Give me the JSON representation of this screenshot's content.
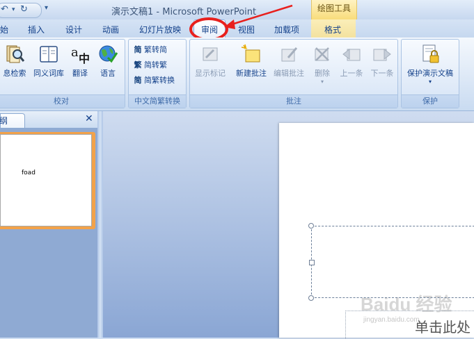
{
  "window": {
    "title": "演示文稿1 - Microsoft PowerPoint",
    "context_tab_header": "绘图工具"
  },
  "quick_access": {
    "undo_icon": "↶",
    "redo_icon": "↻",
    "dropdown_icon": "▾"
  },
  "tabs": [
    {
      "label": "始"
    },
    {
      "label": "插入"
    },
    {
      "label": "设计"
    },
    {
      "label": "动画"
    },
    {
      "label": "幻灯片放映"
    },
    {
      "label": "审阅",
      "selected": true
    },
    {
      "label": "视图"
    },
    {
      "label": "加载项"
    },
    {
      "label": "格式"
    }
  ],
  "ribbon": {
    "groups": [
      {
        "label": "校对",
        "buttons": [
          {
            "label": "息检索",
            "icon": "research-icon"
          },
          {
            "label": "同义词库",
            "icon": "thesaurus-icon"
          },
          {
            "label": "翻译",
            "icon": "translate-icon"
          },
          {
            "label": "语言",
            "icon": "language-globe-icon"
          }
        ]
      },
      {
        "label": "中文简繁转换",
        "buttons": [
          {
            "label": "繁转简",
            "icon_glyph": "简"
          },
          {
            "label": "简转繁",
            "icon_glyph": "繁"
          },
          {
            "label": "简繁转换",
            "icon_glyph": "简"
          }
        ]
      },
      {
        "label": "批注",
        "buttons": [
          {
            "label": "显示标记",
            "enabled": false
          },
          {
            "label": "新建批注",
            "enabled": true
          },
          {
            "label": "编辑批注",
            "enabled": false
          },
          {
            "label": "删除",
            "enabled": false
          },
          {
            "label": "上一条",
            "enabled": false
          },
          {
            "label": "下一条",
            "enabled": false
          }
        ]
      },
      {
        "label": "保护",
        "buttons": [
          {
            "label": "保护演示文稿",
            "icon": "protect-document-icon"
          }
        ]
      }
    ]
  },
  "outline_pane": {
    "tab_label": "纲",
    "close_glyph": "✕",
    "slide_thumbnail_text": "foad"
  },
  "slide": {
    "subtitle_placeholder": "单击此处",
    "watermark": "Baidu 经验",
    "watermark_sub": "jingyan.baidu.com"
  },
  "colors": {
    "highlight_ring": "#e8201d",
    "selected_thumbnail_border": "#f2a24a",
    "context_tab": "#f8dc7b"
  }
}
